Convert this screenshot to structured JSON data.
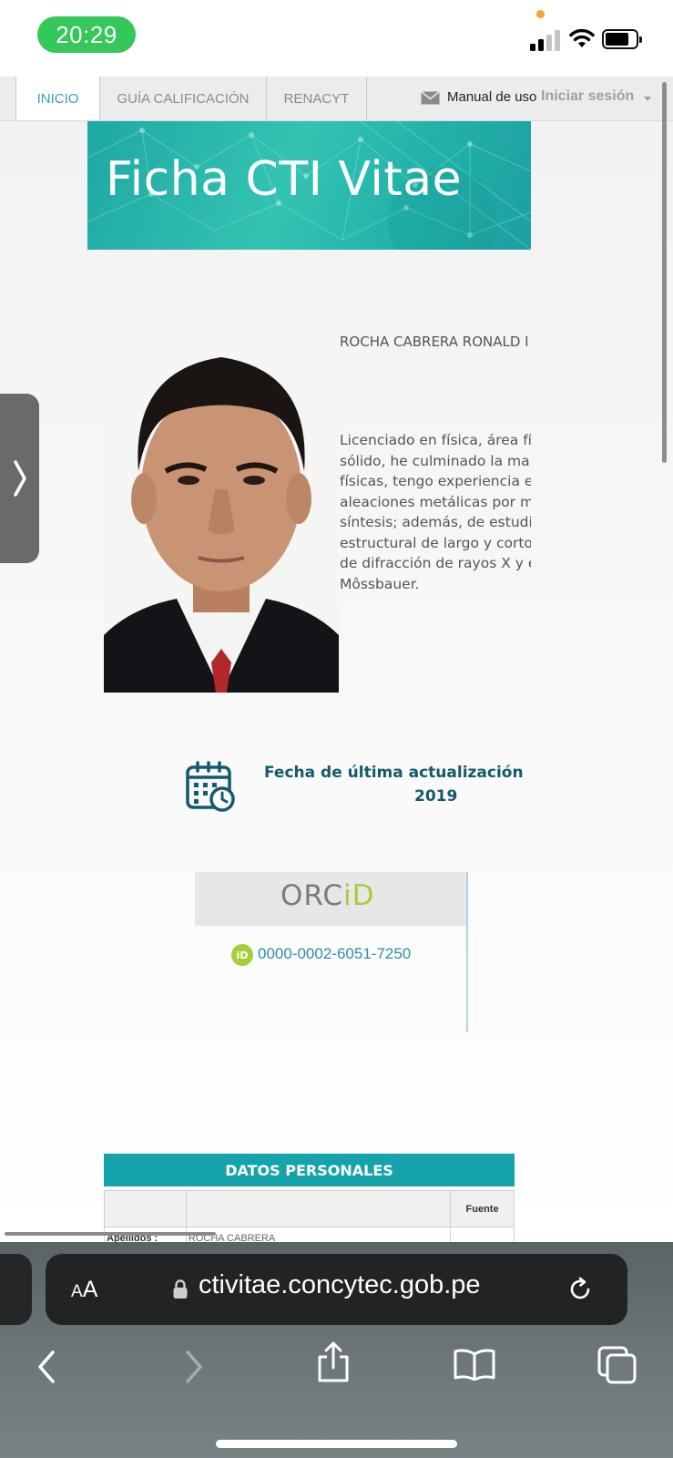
{
  "status_bar": {
    "time": "20:29"
  },
  "nav": {
    "tabs": [
      "INICIO",
      "GUÍA CALIFICACIÓN",
      "RENACYT"
    ],
    "manual_label": "Manual de uso",
    "login_label": "Iniciar sesión"
  },
  "banner": {
    "title": "Ficha CTI Vitae"
  },
  "profile": {
    "name": "ROCHA CABRERA RONALD I",
    "bio_lines": [
      "Licenciado en física, área fí",
      "sólido, he culminado la ma",
      "físicas, tengo experiencia e",
      "aleaciones metálicas por m",
      "síntesis; además, de estudi",
      "estructural de largo y corto",
      "de difracción de rayos X y e",
      "Môssbauer."
    ]
  },
  "update": {
    "label": "Fecha de última actualización",
    "year": "2019"
  },
  "orcid": {
    "logo_left": "ORC",
    "logo_id": "iD",
    "badge": "iD",
    "number": "0000-0002-6051-7250"
  },
  "datos_personales": {
    "header": "DATOS PERSONALES",
    "fuente_label": "Fuente",
    "row_label": "Apellidos :",
    "row_value": "ROCHA CABRERA"
  },
  "safari": {
    "aa_small": "A",
    "aa_big": "A",
    "url": "ctivitae.concytec.gob.pe"
  },
  "colors": {
    "accent_teal": "#14a3aa",
    "orcid_green": "#a6ce39",
    "link_blue": "#2b8fa8",
    "status_green": "#34c759"
  },
  "icons": [
    "mail-icon",
    "calendar-clock-icon",
    "lock-icon",
    "reload-icon",
    "back-icon",
    "forward-icon",
    "share-icon",
    "bookmarks-icon",
    "tabs-icon",
    "chevron-right-icon"
  ]
}
